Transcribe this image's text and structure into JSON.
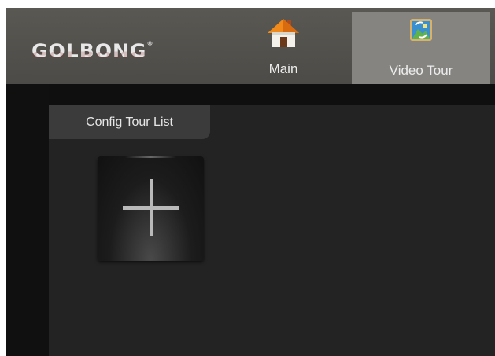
{
  "brand": {
    "logo_text": "GOLBONG",
    "registered_mark": "®"
  },
  "nav": {
    "tabs": [
      {
        "label": "Main",
        "icon": "home-icon",
        "selected": false
      },
      {
        "label": "Video Tour",
        "icon": "video-tour-icon",
        "selected": true
      }
    ]
  },
  "content": {
    "subtab_label": "Config Tour List",
    "add_icon": "plus-icon"
  },
  "colors": {
    "topbar": "#545250",
    "selected_tab": "#858480",
    "panel": "#232323",
    "text": "#ececec"
  }
}
